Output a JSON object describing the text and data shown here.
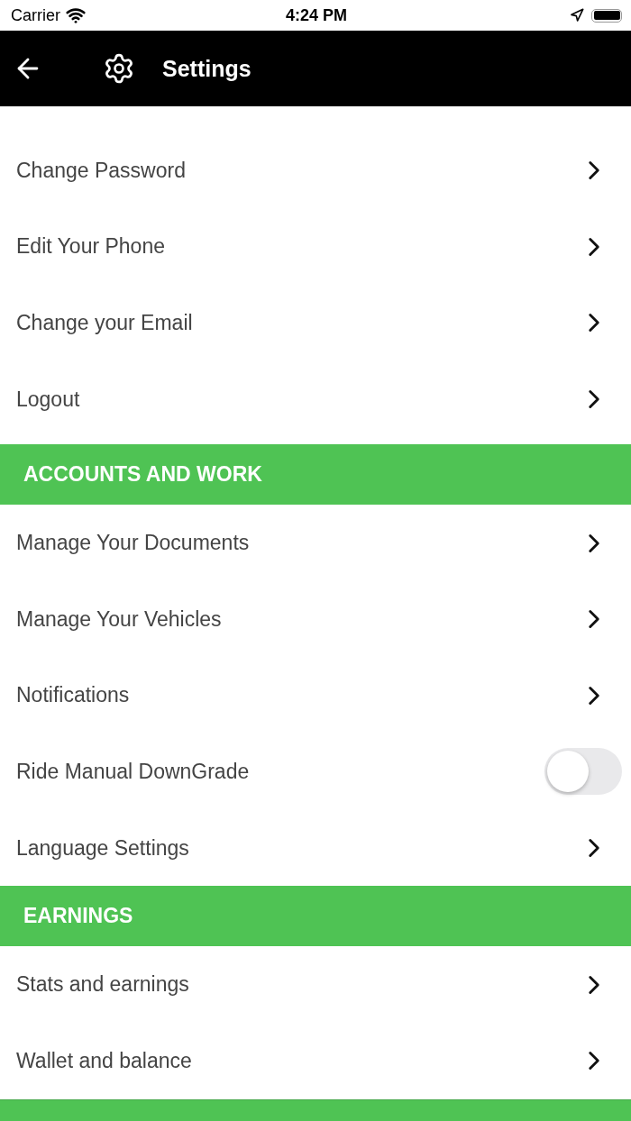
{
  "status_bar": {
    "carrier": "Carrier",
    "time": "4:24 PM"
  },
  "header": {
    "title": "Settings"
  },
  "sections": [
    {
      "items": [
        {
          "kind": "link",
          "label": "Change Password"
        },
        {
          "kind": "link",
          "label": "Edit Your Phone"
        },
        {
          "kind": "link",
          "label": "Change your Email"
        },
        {
          "kind": "link",
          "label": "Logout"
        }
      ]
    },
    {
      "title": "ACCOUNTS AND WORK",
      "items": [
        {
          "kind": "link",
          "label": "Manage Your Documents"
        },
        {
          "kind": "link",
          "label": "Manage Your Vehicles"
        },
        {
          "kind": "link",
          "label": "Notifications"
        },
        {
          "kind": "toggle",
          "label": "Ride Manual DownGrade",
          "on": false
        },
        {
          "kind": "link",
          "label": "Language Settings"
        }
      ]
    },
    {
      "title": "EARNINGS",
      "items": [
        {
          "kind": "link",
          "label": "Stats and earnings"
        },
        {
          "kind": "link",
          "label": "Wallet and balance"
        }
      ]
    }
  ]
}
